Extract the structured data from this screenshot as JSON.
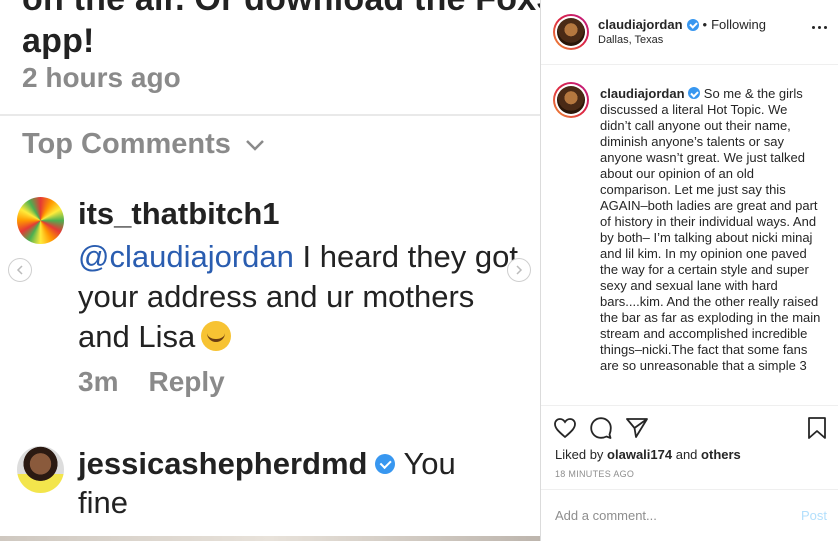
{
  "story": {
    "top_line_1": "on the air. Or download the FoxSoul",
    "top_line_2": "app!",
    "time_ago": "2 hours ago",
    "top_comments_label": "Top Comments",
    "comments": [
      {
        "username": "its_thatbitch1",
        "mention": "@claudiajordan",
        "text": " I heard they got your address and ur mothers and Lisa",
        "time": "3m",
        "reply_label": "Reply"
      },
      {
        "username": "jessicashepherdmd",
        "text_line1": "You",
        "text_line2": "fine"
      }
    ]
  },
  "post": {
    "username": "claudiajordan",
    "follow_status": "Following",
    "location": "Dallas, Texas",
    "caption": "So me & the girls discussed a literal Hot Topic. We didn’t call anyone out their name, diminish anyone’s talents or say anyone wasn’t great. We just talked about our opinion of an old comparison. Let me just say this AGAIN–both ladies are great and part of history in their individual ways. And by both– I’m talking about nicki minaj and lil kim. In my opinion one paved the way for a certain style and super sexy and sexual lane with hard bars....kim. And the other really raised the bar as far as exploding in the main stream and accomplished incredible things–nicki.The fact that some fans are so unreasonable that a simple 3",
    "likes_prefix": "Liked by",
    "likes_user": "olawali174",
    "likes_and": "and",
    "likes_others": "others",
    "posted_time": "18 MINUTES AGO",
    "comment_placeholder": "Add a comment...",
    "post_label": "Post"
  },
  "colors": {
    "verified": "#3897f0",
    "mention": "#2a5db0",
    "muted": "#8a8a8a",
    "post_disabled": "#b2dffc"
  }
}
